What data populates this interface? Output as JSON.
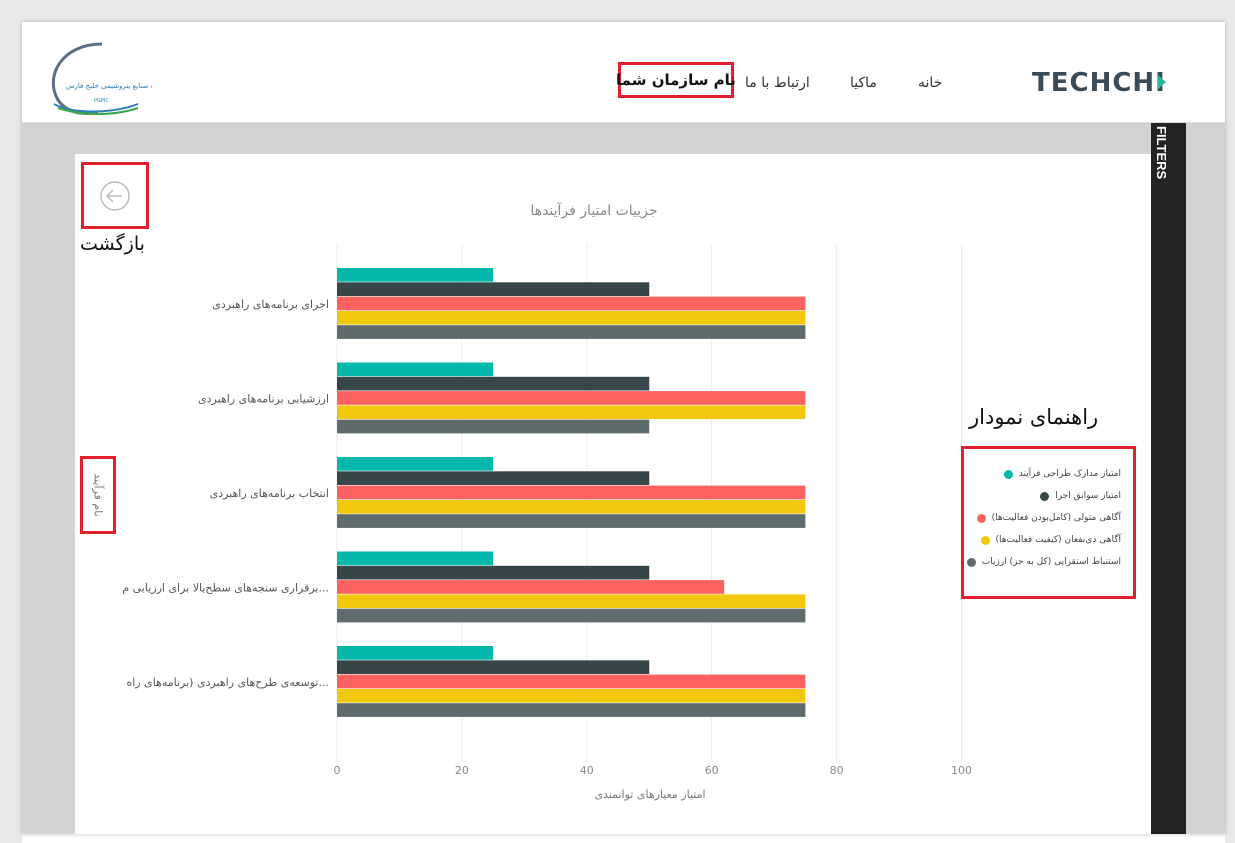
{
  "header": {
    "brand": "TECHCHI",
    "nav": [
      {
        "label": "خانه"
      },
      {
        "label": "ماکیا"
      },
      {
        "label": "ارتباط با ما"
      }
    ],
    "org_name": "نام سازمان شما",
    "partner_logo_text": "شرکت صنایع پتروشیمی خلیج فارس",
    "partner_logo_abbr": "PGPIC"
  },
  "filters_label": "FILTERS",
  "back_label": "بازگشت",
  "legend_title": "راهنمای نمودار",
  "colors": {
    "teal": "#01b8aa",
    "dark": "#374649",
    "coral": "#fd625e",
    "yellow": "#f2c80f",
    "gray": "#5f6b6d",
    "highlight": "#e0202b"
  },
  "chart_data": {
    "type": "bar",
    "orientation": "horizontal",
    "title": "جزییات امتیاز فرآیندها",
    "xlabel": "امتیاز معیارهای توانمندی",
    "ylabel": "نام فرآیند",
    "xlim": [
      0,
      100
    ],
    "xticks": [
      "0",
      "20",
      "40",
      "60",
      "80",
      "100"
    ],
    "grid": true,
    "legend_position": "right",
    "categories": [
      "اجرای برنامه‌های راهبردی",
      "ارزشیابی برنامه‌های راهبردی",
      "انتخاب برنامه‌های راهبردی",
      "برقراری سنجه‌های سطح‌بالا برای ارزیابی م...",
      "توسعه‌ی طرح‌های راهبردی (برنامه‌های راه..."
    ],
    "series": [
      {
        "name": "امتیاز مدارک طراحی فرآیند",
        "color": "#01b8aa",
        "values": [
          25,
          25,
          25,
          25,
          25
        ]
      },
      {
        "name": "امتیاز سوابق اجرا",
        "color": "#374649",
        "values": [
          50,
          50,
          50,
          50,
          50
        ]
      },
      {
        "name": "آگاهی متولی (کامل‌بودن فعالیت‌ها)",
        "color": "#fd625e",
        "values": [
          75,
          75,
          75,
          62,
          75
        ]
      },
      {
        "name": "آگاهی ذی‌نفعان (کیفیت فعالیت‌ها)",
        "color": "#f2c80f",
        "values": [
          75,
          75,
          75,
          75,
          75
        ]
      },
      {
        "name": "استنباط استقرایی (کل به جز) ارزیاب",
        "color": "#5f6b6d",
        "values": [
          75,
          50,
          75,
          75,
          75
        ]
      }
    ]
  }
}
